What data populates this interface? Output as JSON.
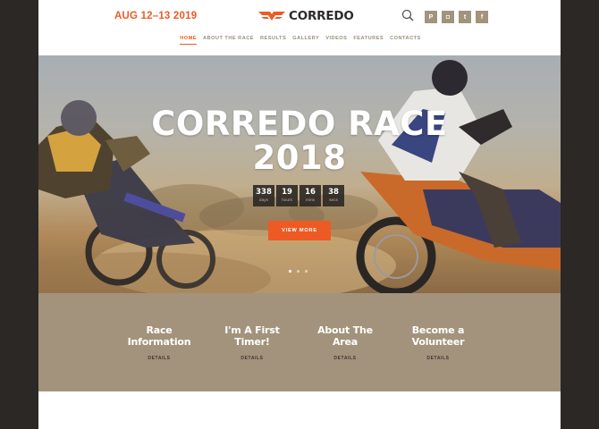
{
  "header": {
    "event_date": "AUG 12–13 2019",
    "logo_text": "CORREDO",
    "social": [
      {
        "icon": "pinterest-icon",
        "glyph": "P"
      },
      {
        "icon": "instagram-icon",
        "glyph": "◘"
      },
      {
        "icon": "twitter-icon",
        "glyph": "t"
      },
      {
        "icon": "facebook-icon",
        "glyph": "f"
      }
    ]
  },
  "nav": {
    "items": [
      {
        "label": "HOME",
        "active": true
      },
      {
        "label": "ABOUT THE RACE"
      },
      {
        "label": "RESULTS"
      },
      {
        "label": "GALLERY"
      },
      {
        "label": "VIDEOS"
      },
      {
        "label": "FEATURES"
      },
      {
        "label": "CONTACTS"
      }
    ]
  },
  "hero": {
    "title_line1": "CORREDO RACE",
    "title_line2": "2018",
    "countdown": [
      {
        "value": "338",
        "unit": "days"
      },
      {
        "value": "19",
        "unit": "hours"
      },
      {
        "value": "16",
        "unit": "mins"
      },
      {
        "value": "38",
        "unit": "secs"
      }
    ],
    "cta_label": "VIEW MORE",
    "slides": 3,
    "active_slide": 1
  },
  "cards": [
    {
      "title_line1": "Race",
      "title_line2": "Information",
      "link": "DETAILS"
    },
    {
      "title_line1": "I'm A First",
      "title_line2": "Timer!",
      "link": "DETAILS"
    },
    {
      "title_line1": "About The",
      "title_line2": "Area",
      "link": "DETAILS"
    },
    {
      "title_line1": "Become a",
      "title_line2": "Volunteer",
      "link": "DETAILS"
    }
  ],
  "colors": {
    "accent": "#ee5a24",
    "band": "#a3937c",
    "frame": "#2b2826"
  }
}
